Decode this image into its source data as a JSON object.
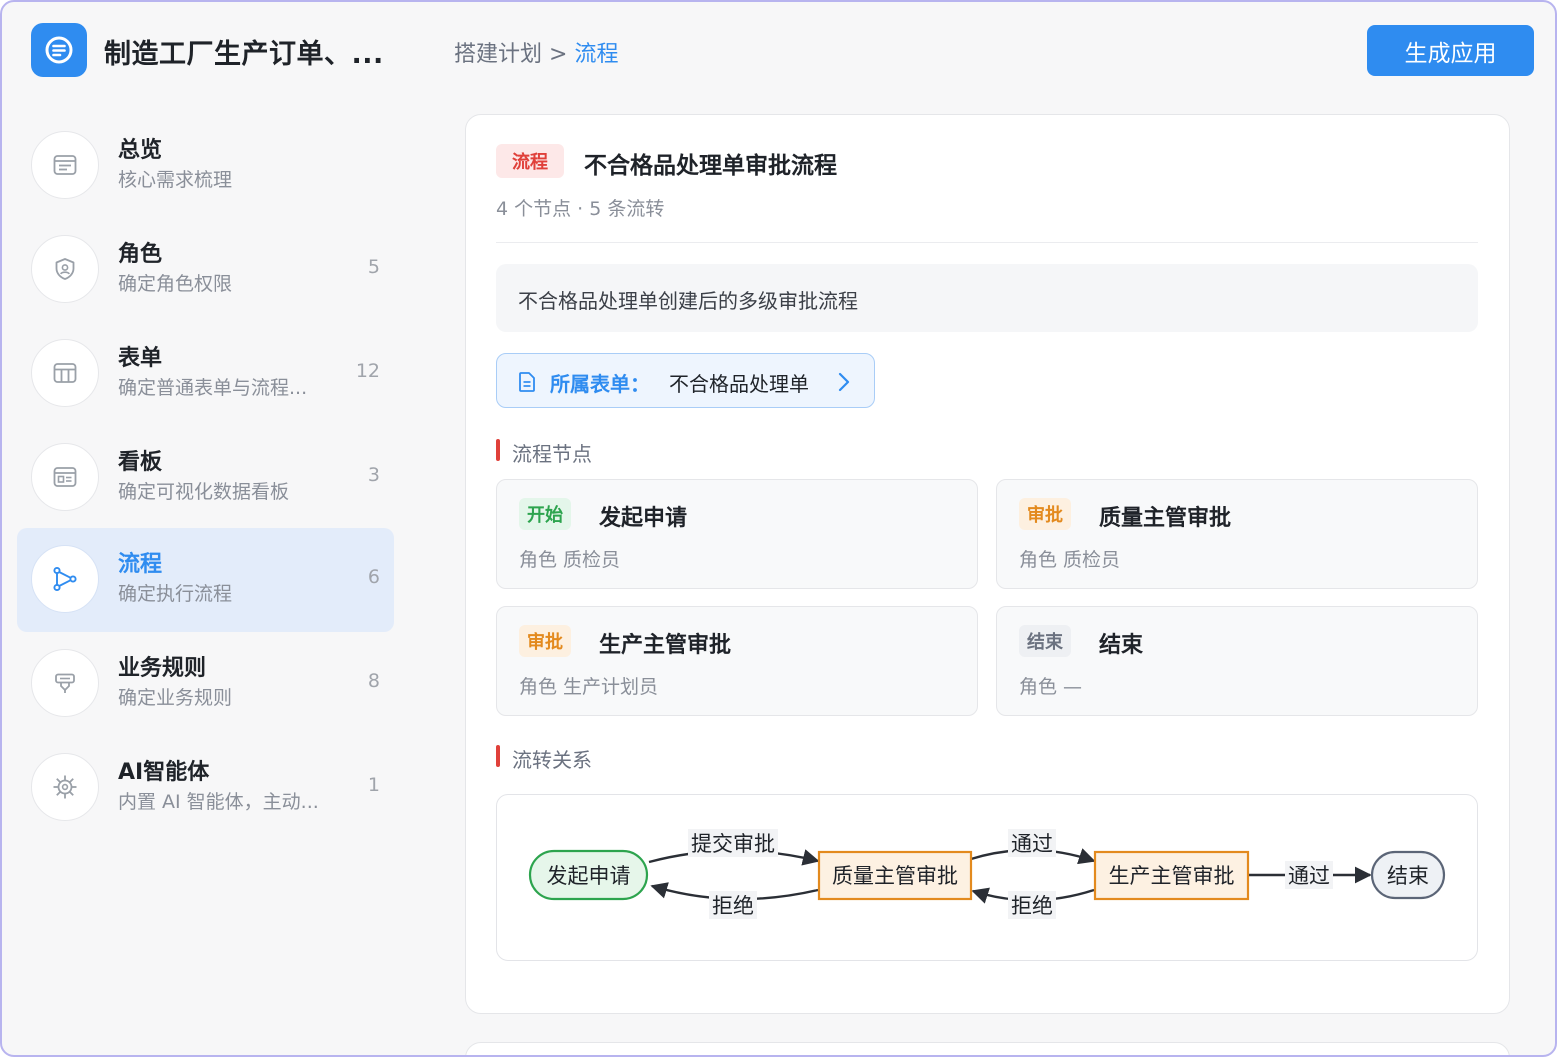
{
  "app": {
    "title": "制造工厂生产订单、...",
    "logo_icon": "document-list-icon",
    "generate_button": "生成应用"
  },
  "breadcrumb": {
    "parent": "搭建计划",
    "separator": ">",
    "current": "流程"
  },
  "sidebar": {
    "items": [
      {
        "id": "overview",
        "title": "总览",
        "subtitle": "核心需求梳理",
        "count": "",
        "icon": "overview-icon"
      },
      {
        "id": "roles",
        "title": "角色",
        "subtitle": "确定角色权限",
        "count": "5",
        "icon": "role-shield-icon"
      },
      {
        "id": "forms",
        "title": "表单",
        "subtitle": "确定普通表单与流程...",
        "count": "12",
        "icon": "table-icon"
      },
      {
        "id": "dashboards",
        "title": "看板",
        "subtitle": "确定可视化数据看板",
        "count": "3",
        "icon": "dashboard-icon"
      },
      {
        "id": "flows",
        "title": "流程",
        "subtitle": "确定执行流程",
        "count": "6",
        "icon": "flow-icon",
        "active": true
      },
      {
        "id": "rules",
        "title": "业务规则",
        "subtitle": "确定业务规则",
        "count": "8",
        "icon": "rule-icon"
      },
      {
        "id": "agents",
        "title": "AI智能体",
        "subtitle": "内置 AI 智能体，主动...",
        "count": "1",
        "icon": "ai-agent-icon"
      }
    ]
  },
  "detail": {
    "tag": "流程",
    "title": "不合格品处理单审批流程",
    "meta": "4 个节点 · 5 条流转",
    "description": "不合格品处理单创建后的多级审批流程",
    "form_link": {
      "label": "所属表单：",
      "value": "不合格品处理单"
    },
    "nodes_section": "流程节点",
    "nodes": [
      {
        "tag": "开始",
        "tag_color": "green",
        "name": "发起申请",
        "role": "角色 质检员"
      },
      {
        "tag": "审批",
        "tag_color": "orange",
        "name": "质量主管审批",
        "role": "角色 质检员"
      },
      {
        "tag": "审批",
        "tag_color": "orange",
        "name": "生产主管审批",
        "role": "角色 生产计划员"
      },
      {
        "tag": "结束",
        "tag_color": "gray",
        "name": "结束",
        "role": "角色 —"
      }
    ],
    "transitions_section": "流转关系",
    "diagram": {
      "nodes": [
        "发起申请",
        "质量主管审批",
        "生产主管审批",
        "结束"
      ],
      "edges": [
        {
          "from": "发起申请",
          "to": "质量主管审批",
          "label": "提交审批"
        },
        {
          "from": "质量主管审批",
          "to": "发起申请",
          "label": "拒绝"
        },
        {
          "from": "质量主管审批",
          "to": "生产主管审批",
          "label": "通过"
        },
        {
          "from": "生产主管审批",
          "to": "质量主管审批",
          "label": "拒绝"
        },
        {
          "from": "生产主管审批",
          "to": "结束",
          "label": "通过"
        }
      ]
    }
  },
  "colors": {
    "accent": "#2f8cf0",
    "danger": "#e0403a",
    "start_node": "#2da44e",
    "approve_node": "#e38a1e",
    "end_node": "#5b6577"
  }
}
